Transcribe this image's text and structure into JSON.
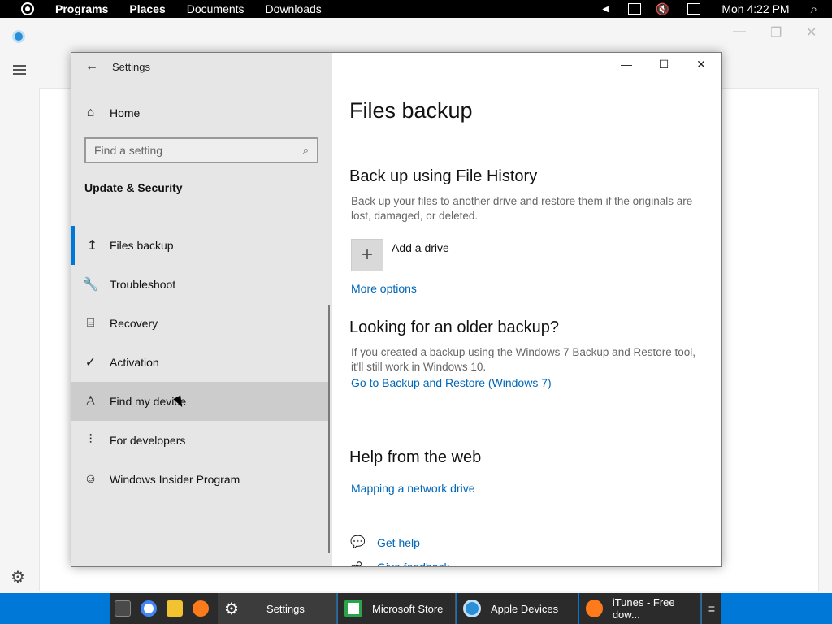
{
  "topbar": {
    "menus": [
      "Programs",
      "Places",
      "Documents",
      "Downloads"
    ],
    "clock": "Mon 4:22 PM",
    "icons": [
      "network-icon",
      "volume-muted-icon",
      "notification-icon",
      "search-icon"
    ]
  },
  "settings": {
    "title": "Settings",
    "home": "Home",
    "search_placeholder": "Find a setting",
    "section": "Update & Security",
    "nav": [
      {
        "label": "Files backup",
        "icon": "upload-arrow-icon",
        "active": true
      },
      {
        "label": "Troubleshoot",
        "icon": "wrench-icon"
      },
      {
        "label": "Recovery",
        "icon": "recovery-icon"
      },
      {
        "label": "Activation",
        "icon": "check-circle-icon"
      },
      {
        "label": "Find my device",
        "icon": "person-location-icon",
        "hover": true
      },
      {
        "label": "For developers",
        "icon": "developer-icon"
      },
      {
        "label": "Windows Insider Program",
        "icon": "insider-icon"
      }
    ]
  },
  "main": {
    "page_title": "Files backup",
    "file_history": {
      "heading": "Back up using File History",
      "description": "Back up your files to another drive and restore them if the originals are lost, damaged, or deleted.",
      "add_drive": "Add a drive",
      "more_options": "More options"
    },
    "older_backup": {
      "heading": "Looking for an older backup?",
      "description": "If you created a backup using the Windows 7 Backup and Restore tool, it'll still work in Windows 10.",
      "link": "Go to Backup and Restore (Windows 7)"
    },
    "help": {
      "heading": "Help from the web",
      "link": "Mapping a network drive"
    },
    "get_help": "Get help",
    "give_feedback": "Give feedback"
  },
  "taskbar": {
    "buttons": [
      {
        "label": "Settings",
        "icon": "gear-icon",
        "active": true
      },
      {
        "label": "Microsoft Store",
        "icon": "store-icon"
      },
      {
        "label": "Apple Devices",
        "icon": "sync-icon"
      },
      {
        "label": "iTunes - Free dow...",
        "icon": "firefox-icon"
      }
    ]
  },
  "colors": {
    "accent": "#0078d7",
    "link": "#0067b8",
    "sidebar": "#e6e6e6"
  }
}
